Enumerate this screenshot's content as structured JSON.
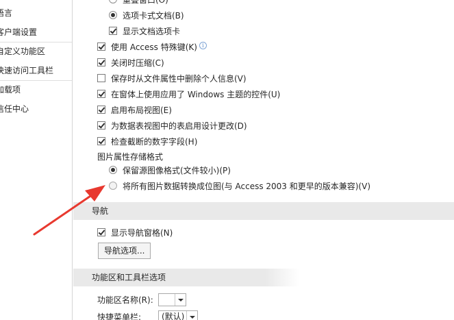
{
  "sidebar": {
    "items": [
      {
        "label": "语言"
      },
      {
        "label": "客户端设置"
      },
      {
        "label": "自定义功能区"
      },
      {
        "label": "快速访问工具栏"
      },
      {
        "label": "加载项"
      },
      {
        "label": "信任中心"
      }
    ]
  },
  "app_options": {
    "doc_window_mode": {
      "overlap_label": "重叠窗口(O)",
      "tabbed_label": "选项卡式文档(B)",
      "show_tabs_label": "显示文档选项卡"
    },
    "use_access_special_keys_label": "使用 Access 特殊键(K)",
    "compact_on_close_label": "关闭时压缩(C)",
    "remove_personal_info_label": "保存时从文件属性中删除个人信息(V)",
    "use_windows_theme_label": "在窗体上使用应用了 Windows 主题的控件(U)",
    "enable_layout_view_label": "启用布局视图(E)",
    "enable_design_changes_label": "为数据表视图中的表启用设计更改(D)",
    "check_truncated_label": "检查截断的数字字段(H)",
    "picture_format_heading": "图片属性存储格式",
    "preserve_source_format_label": "保留源图像格式(文件较小)(P)",
    "convert_to_bitmap_label": "将所有图片数据转换成位图(与 Access 2003 和更早的版本兼容)(V)"
  },
  "navigation": {
    "heading": "导航",
    "show_nav_pane_label": "显示导航窗格(N)",
    "nav_options_button": "导航选项..."
  },
  "ribbon_toolbar": {
    "heading": "功能区和工具栏选项",
    "ribbon_name_label": "功能区名称(R):",
    "ribbon_name_value": "",
    "shortcut_menu_label": "快捷菜单栏:",
    "shortcut_menu_value": "(默认)"
  },
  "colors": {
    "annotation_arrow": "#e8392f",
    "section_band": "#e9e9e9"
  }
}
